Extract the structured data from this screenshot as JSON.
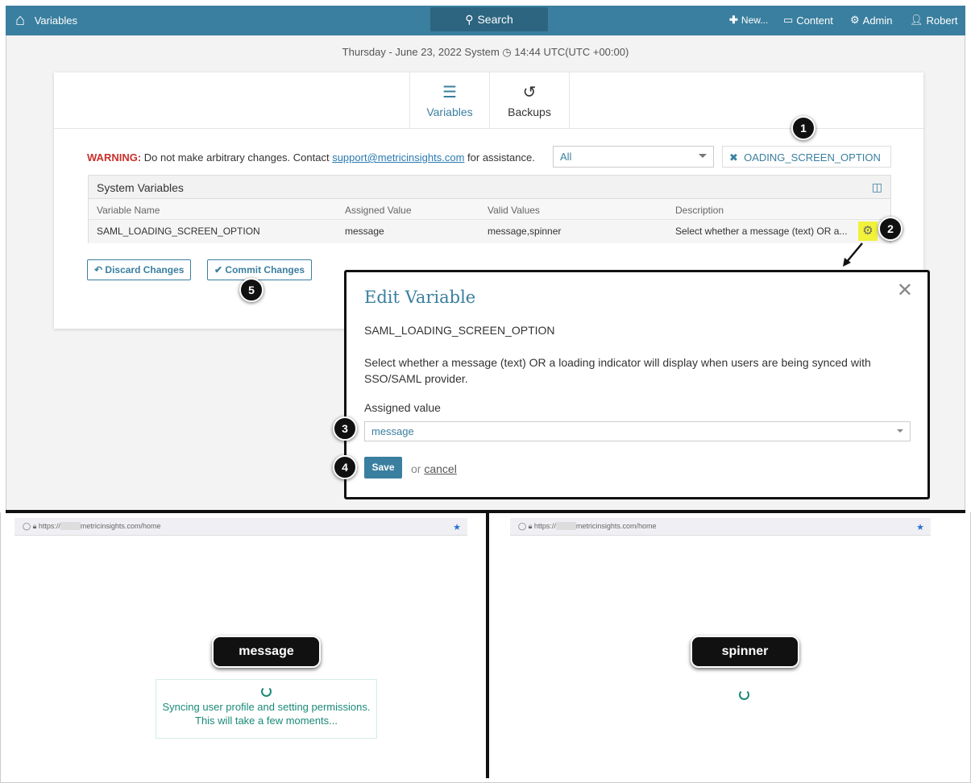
{
  "header": {
    "title": "Variables",
    "search": "Search",
    "new": "New...",
    "content": "Content",
    "admin": "Admin",
    "user": "Robert"
  },
  "date_line": "Thursday - June 23, 2022 System ◷ 14:44 UTC(UTC +00:00)",
  "tabs": [
    {
      "label": "Variables",
      "active": true
    },
    {
      "label": "Backups"
    }
  ],
  "warning": {
    "label": "WARNING:",
    "text1": "Do not make arbitrary changes. Contact",
    "email": "support@metricinsights.com",
    "text2": "for assistance."
  },
  "filter": {
    "select": "All",
    "chip": "OADING_SCREEN_OPTION"
  },
  "table": {
    "title": "System Variables",
    "columns": [
      "Variable Name",
      "Assigned Value",
      "Valid Values",
      "Description"
    ],
    "rows": [
      [
        "SAML_LOADING_SCREEN_OPTION",
        "message",
        "message,spinner",
        "Select whether a message (text) OR a..."
      ]
    ]
  },
  "buttons": {
    "discard": "Discard Changes",
    "commit": "Commit Changes"
  },
  "modal": {
    "title": "Edit Variable",
    "name": "SAML_LOADING_SCREEN_OPTION",
    "description": "Select whether a message (text) OR a loading indicator will display when users are being synced with SSO/SAML provider.",
    "assigned_label": "Assigned value",
    "assigned_value": "message",
    "save": "Save",
    "or": "or",
    "cancel": "cancel"
  },
  "callouts": [
    "1",
    "2",
    "3",
    "4",
    "5"
  ],
  "browser": {
    "url_prefix": "https://",
    "url_domain": "metricinsights.com/home"
  },
  "examples": {
    "message_label": "message",
    "spinner_label": "spinner",
    "message_line1": "Syncing user profile and setting permissions.",
    "message_line2": "This will take a few moments..."
  },
  "colors": {
    "accent": "#3a7f9f",
    "warning": "#c9302c",
    "spinner": "#1a8a78"
  }
}
